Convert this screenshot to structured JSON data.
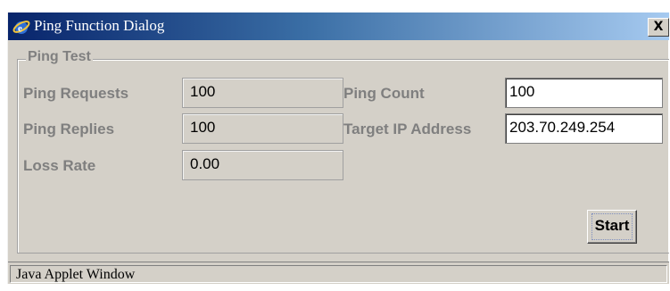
{
  "window": {
    "title": "Ping Function Dialog",
    "close_label": "X",
    "icon": "ie-icon"
  },
  "group": {
    "legend": "Ping Test"
  },
  "fields": {
    "ping_requests": {
      "label": "Ping Requests",
      "value": "100"
    },
    "ping_replies": {
      "label": "Ping Replies",
      "value": "100"
    },
    "loss_rate": {
      "label": "Loss Rate",
      "value": "0.00"
    },
    "ping_count": {
      "label": "Ping Count",
      "value": "100"
    },
    "target_ip": {
      "label": "Target IP Address",
      "value": "203.70.249.254"
    }
  },
  "actions": {
    "start_label": "Start"
  },
  "status": {
    "text": "Java Applet Window"
  },
  "colors": {
    "title_start": "#08246b",
    "title_end": "#a6caf0",
    "dialog_bg": "#d4d0c8",
    "label_gray": "#7f7f7f"
  }
}
